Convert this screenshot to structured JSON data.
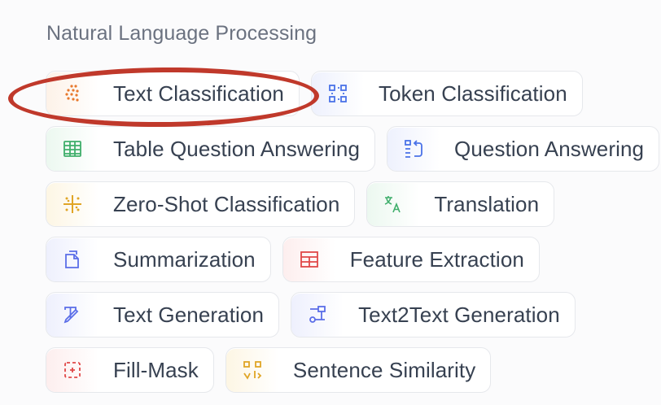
{
  "section": {
    "title": "Natural Language Processing"
  },
  "tasks": [
    {
      "label": "Text Classification",
      "icon": "text-classification-icon",
      "color": "#e8792e"
    },
    {
      "label": "Token Classification",
      "icon": "token-classification-icon",
      "color": "#4a72e8"
    },
    {
      "label": "Table Question Answering",
      "icon": "table-icon",
      "color": "#3fae6b"
    },
    {
      "label": "Question Answering",
      "icon": "question-answering-icon",
      "color": "#4a72e8"
    },
    {
      "label": "Zero-Shot Classification",
      "icon": "zero-shot-icon",
      "color": "#e0a526"
    },
    {
      "label": "Translation",
      "icon": "translation-icon",
      "color": "#3fae6b"
    },
    {
      "label": "Summarization",
      "icon": "summarization-icon",
      "color": "#5b6ee8"
    },
    {
      "label": "Feature Extraction",
      "icon": "feature-extraction-icon",
      "color": "#e04848"
    },
    {
      "label": "Text Generation",
      "icon": "text-generation-icon",
      "color": "#5b6ee8"
    },
    {
      "label": "Text2Text Generation",
      "icon": "text2text-icon",
      "color": "#5b6ee8"
    },
    {
      "label": "Fill-Mask",
      "icon": "fill-mask-icon",
      "color": "#e04848"
    },
    {
      "label": "Sentence Similarity",
      "icon": "sentence-similarity-icon",
      "color": "#e0a526"
    }
  ],
  "annotation": {
    "highlighted": "Text Classification",
    "color": "#c0392b"
  }
}
